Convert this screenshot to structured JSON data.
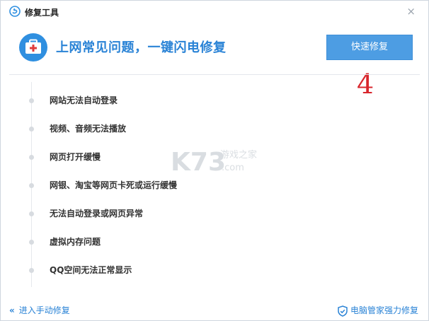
{
  "window": {
    "title": "修复工具",
    "close_symbol": "×"
  },
  "header": {
    "headline": "上网常见问题，一键闪电修复",
    "primary_button": "快速修复",
    "annotation": "4"
  },
  "issues": [
    {
      "label": "网站无法自动登录"
    },
    {
      "label": "视频、音频无法播放"
    },
    {
      "label": "网页打开缓慢"
    },
    {
      "label": "网银、淘宝等网页卡死或运行缓慢"
    },
    {
      "label": "无法自动登录或网页异常"
    },
    {
      "label": "虚拟内存问题"
    },
    {
      "label": "QQ空间无法正常显示"
    }
  ],
  "footer": {
    "back_chevron": "«",
    "back_label": "进入手动修复",
    "brand_label": "电脑管家强力修复"
  },
  "watermark": {
    "text": "K73",
    "sub": "游戏之家",
    "url": ".com"
  },
  "colors": {
    "accent": "#2a83d6",
    "button": "#4d9de3",
    "kit": "#2f8fe0",
    "annotation": "#d8262c"
  },
  "icons": {
    "app": "app-logo-icon",
    "close": "close-icon",
    "kit": "first-aid-kit-icon",
    "back": "double-chevron-left-icon",
    "brand": "shield-check-icon"
  }
}
